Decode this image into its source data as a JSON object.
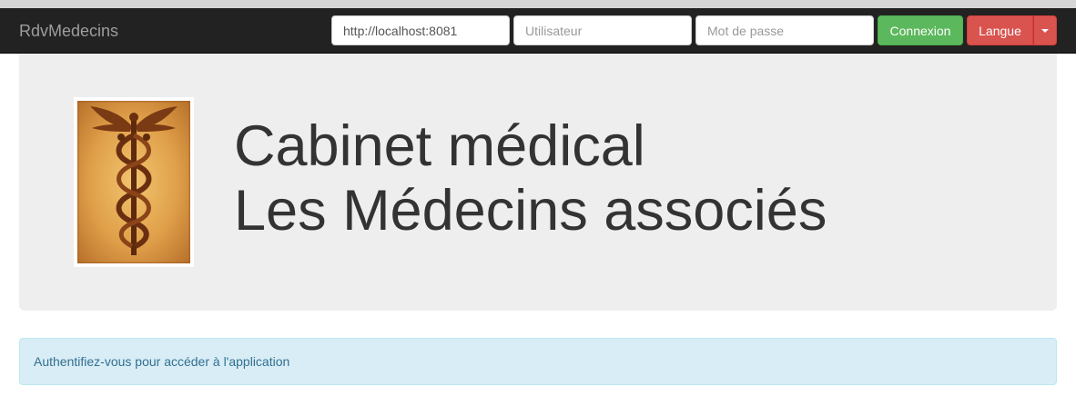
{
  "navbar": {
    "brand": "RdvMedecins",
    "url_field": {
      "value": "http://localhost:8081",
      "placeholder": ""
    },
    "user_field": {
      "value": "",
      "placeholder": "Utilisateur"
    },
    "password_field": {
      "value": "",
      "placeholder": "Mot de passe"
    },
    "login_button": "Connexion",
    "language_button": "Langue",
    "colors": {
      "login": "#5cb85c",
      "language": "#d9534f",
      "navbar_bg": "#222222"
    }
  },
  "jumbotron": {
    "logo_icon": "caduceus-icon",
    "title_line1": "Cabinet médical",
    "title_line2": "Les Médecins associés"
  },
  "alert": {
    "message": "Authentifiez-vous pour accéder à l'application",
    "color": "#d9edf7"
  }
}
